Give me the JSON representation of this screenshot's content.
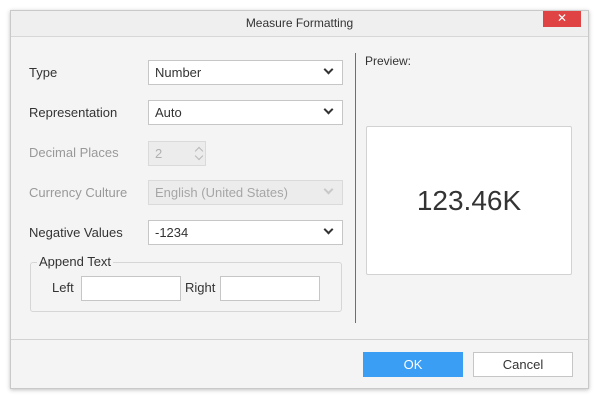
{
  "dialog": {
    "title": "Measure Formatting",
    "close_label": "✕"
  },
  "form": {
    "type_label": "Type",
    "type_value": "Number",
    "representation_label": "Representation",
    "representation_value": "Auto",
    "decimal_places_label": "Decimal Places",
    "decimal_places_value": "2",
    "currency_culture_label": "Currency Culture",
    "currency_culture_value": "English (United States)",
    "negative_values_label": "Negative Values",
    "negative_values_value": "-1234",
    "append_text_label": "Append Text",
    "left_label": "Left",
    "right_label": "Right",
    "left_value": "",
    "right_value": ""
  },
  "preview": {
    "label": "Preview:",
    "value": "123.46K"
  },
  "footer": {
    "ok_label": "OK",
    "cancel_label": "Cancel"
  },
  "colors": {
    "accent": "#3b9ef5",
    "close": "#e04343"
  }
}
